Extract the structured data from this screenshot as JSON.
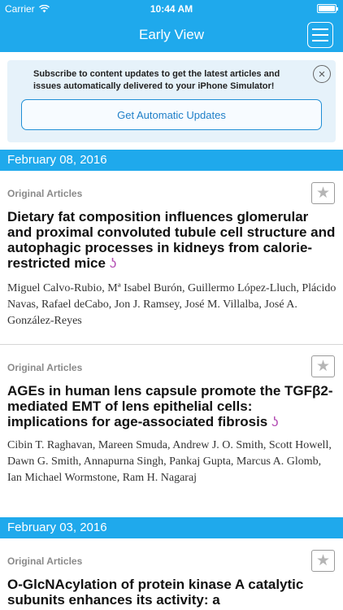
{
  "status_bar": {
    "carrier": "Carrier",
    "time": "10:44 AM"
  },
  "nav": {
    "title": "Early View"
  },
  "banner": {
    "text": "Subscribe to content updates to get the latest articles and issues automatically delivered to your iPhone Simulator!",
    "button_label": "Get Automatic Updates",
    "close_glyph": "×"
  },
  "sections": [
    {
      "date": "February 08, 2016",
      "articles": [
        {
          "category": "Original Articles",
          "title": "Dietary fat composition influences glomerular and proximal convoluted tubule cell structure and autophagic processes in kidneys from calorie-restricted mice",
          "open_access_glyph": "ʖ",
          "authors": "Miguel Calvo-Rubio, Mª Isabel Burón, Guillermo López-Lluch, Plácido Navas, Rafael deCabo, Jon J. Ramsey, José M. Villalba, José A. González-Reyes"
        },
        {
          "category": "Original Articles",
          "title": "AGEs in human lens capsule promote the TGFβ2-mediated EMT of lens epithelial cells: implications for age-associated fibrosis",
          "open_access_glyph": "ʖ",
          "authors": "Cibin T. Raghavan, Mareen Smuda, Andrew J. O. Smith, Scott Howell, Dawn G. Smith, Annapurna Singh, Pankaj Gupta, Marcus A. Glomb, Ian Michael Wormstone, Ram H. Nagaraj"
        }
      ]
    },
    {
      "date": "February 03, 2016",
      "articles": [
        {
          "category": "Original Articles",
          "title": "O-GlcNAcylation of protein kinase A catalytic subunits enhances its activity: a",
          "authors": ""
        }
      ]
    }
  ],
  "icons": {
    "star": "star-icon",
    "menu": "menu-icon",
    "close": "close-icon",
    "wifi": "wifi-icon",
    "battery": "battery-icon",
    "open_access": "open-access-icon"
  },
  "colors": {
    "accent": "#1fa9ec",
    "banner_bg": "#e6f2fa",
    "open_access": "#b34db3"
  }
}
